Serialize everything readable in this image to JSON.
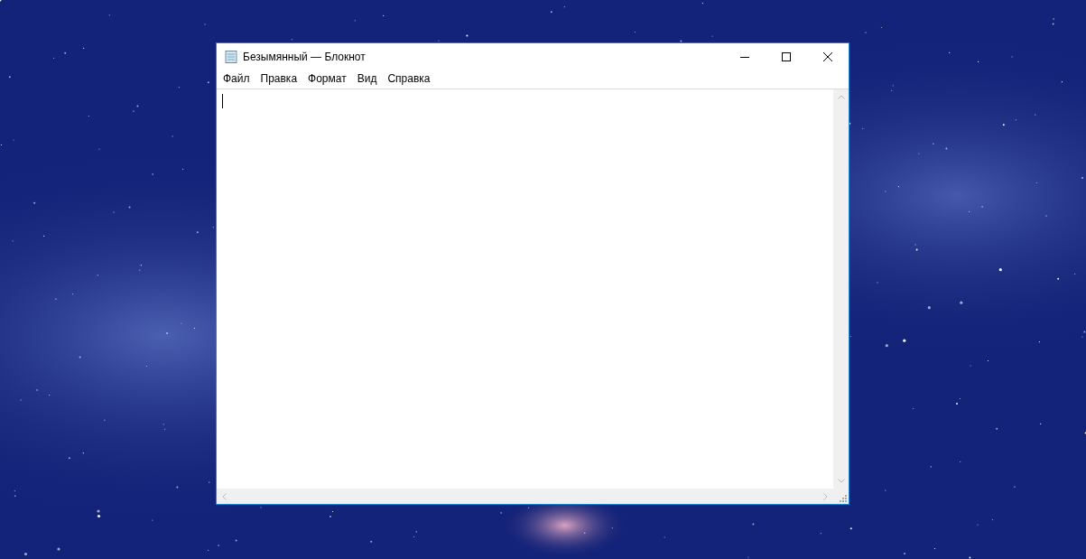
{
  "window": {
    "title": "Безымянный — Блокнот"
  },
  "menu": [
    {
      "label": "Файл"
    },
    {
      "label": "Правка"
    },
    {
      "label": "Формат"
    },
    {
      "label": "Вид"
    },
    {
      "label": "Справка"
    }
  ]
}
